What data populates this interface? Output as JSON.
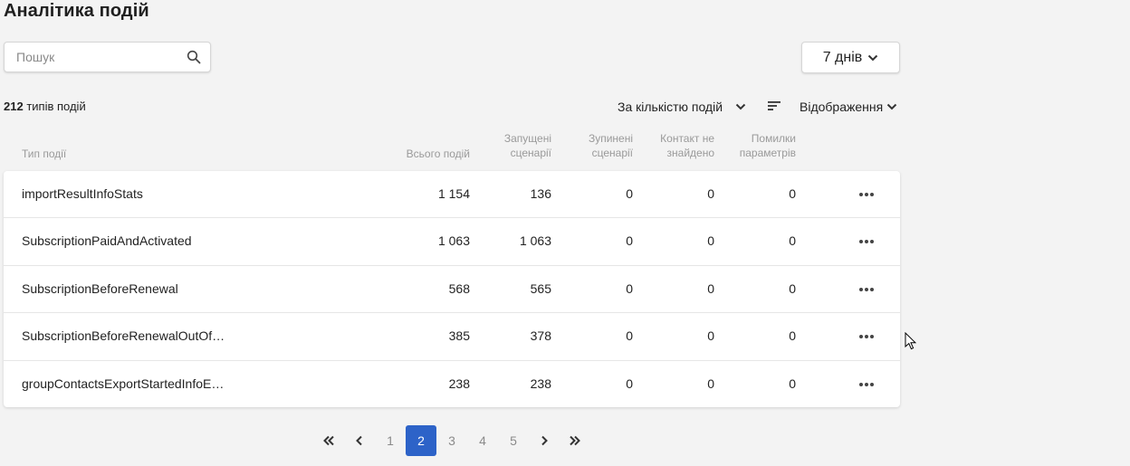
{
  "title": "Аналітика подій",
  "search": {
    "placeholder": "Пошук",
    "value": ""
  },
  "period": {
    "label": "7 днів"
  },
  "summary": {
    "count": "212",
    "count_label": "типів подій"
  },
  "sort": {
    "label": "За кількістю подій"
  },
  "view": {
    "label": "Відображення"
  },
  "columns": {
    "type": "Тип події",
    "total": "Всього подій",
    "started_1": "Запущені",
    "started_2": "сценарії",
    "stopped_1": "Зупинені",
    "stopped_2": "сценарії",
    "contact_1": "Контакт не",
    "contact_2": "знайдено",
    "errors_1": "Помилки",
    "errors_2": "параметрів"
  },
  "rows": [
    {
      "name": "importResultInfoStats",
      "total": "1 154",
      "started": "136",
      "stopped": "0",
      "contact": "0",
      "errors": "0"
    },
    {
      "name": "SubscriptionPaidAndActivated",
      "total": "1 063",
      "started": "1 063",
      "stopped": "0",
      "contact": "0",
      "errors": "0"
    },
    {
      "name": "SubscriptionBeforeRenewal",
      "total": "568",
      "started": "565",
      "stopped": "0",
      "contact": "0",
      "errors": "0"
    },
    {
      "name": "SubscriptionBeforeRenewalOutOf…",
      "total": "385",
      "started": "378",
      "stopped": "0",
      "contact": "0",
      "errors": "0"
    },
    {
      "name": "groupContactsExportStartedInfoE…",
      "total": "238",
      "started": "238",
      "stopped": "0",
      "contact": "0",
      "errors": "0"
    }
  ],
  "pagination": {
    "pages": [
      "1",
      "2",
      "3",
      "4",
      "5"
    ],
    "current": "2"
  },
  "colors": {
    "accent": "#2d63c8",
    "background": "#f3f3f3"
  },
  "icons": [
    "search-icon",
    "chevron-down-icon",
    "sort-order-icon",
    "more-icon",
    "first-page-icon",
    "prev-page-icon",
    "next-page-icon",
    "last-page-icon",
    "mouse-cursor-icon"
  ]
}
